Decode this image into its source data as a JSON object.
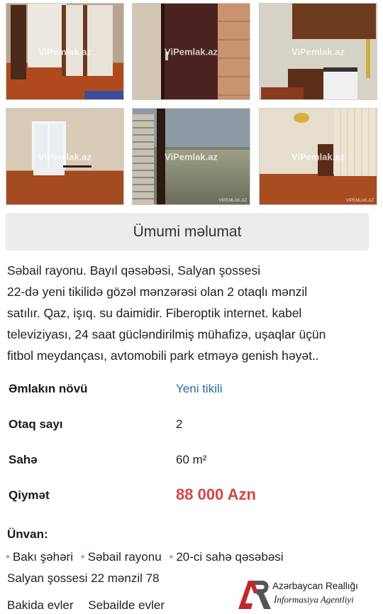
{
  "gallery": {
    "watermark": "ViPemlak.az",
    "tag": "VIPEMLAK.AZ",
    "photos": [
      {
        "subject": "bedroom-with-wardrobe"
      },
      {
        "subject": "entrance-door"
      },
      {
        "subject": "kitchen"
      },
      {
        "subject": "room-with-window"
      },
      {
        "subject": "window-view"
      },
      {
        "subject": "living-room"
      }
    ]
  },
  "section": {
    "title": "Ümumi məlumat"
  },
  "description": {
    "lines": [
      "Səbail rayonu. Bayıl qəsəbəsi, Salyan şossesi",
      "22-də yeni tikilidə gözəl mənzərəsi olan 2 otaqlı mənzil",
      "satılır. Qaz, işıq. su daimidir. Fiberoptik internet. kabel",
      "televiziyası, 24 saat gücləndirilmiş mühafizə, uşaqlar üçün",
      "fitbol meydançası, avtomobili park etməyə genish həyət.."
    ]
  },
  "properties": [
    {
      "key": "Əmlakın növü",
      "value": "Yeni tikili"
    },
    {
      "key": "Otaq sayı",
      "value": "2"
    },
    {
      "key": "Sahə",
      "value": "60 m²"
    },
    {
      "key": "Qiymət",
      "value": "88 000 Azn"
    }
  ],
  "address": {
    "label": "Ünvan:",
    "parts": [
      "Bakı şəhəri",
      "Səbail rayonu",
      "20-ci sahə qəsəbəsi"
    ],
    "street": "Salyan şossesi 22 mənzil 78"
  },
  "tags": [
    "Bakida evler",
    "Sebailde evler"
  ],
  "logo": {
    "mark": "AR",
    "line1": "Azərbaycan Reallığı",
    "line2": "İnformasiya Agentliyi"
  },
  "colors": {
    "accent_link": "#2a6ca8",
    "price": "#d64545",
    "logo_red": "#c0282d"
  }
}
